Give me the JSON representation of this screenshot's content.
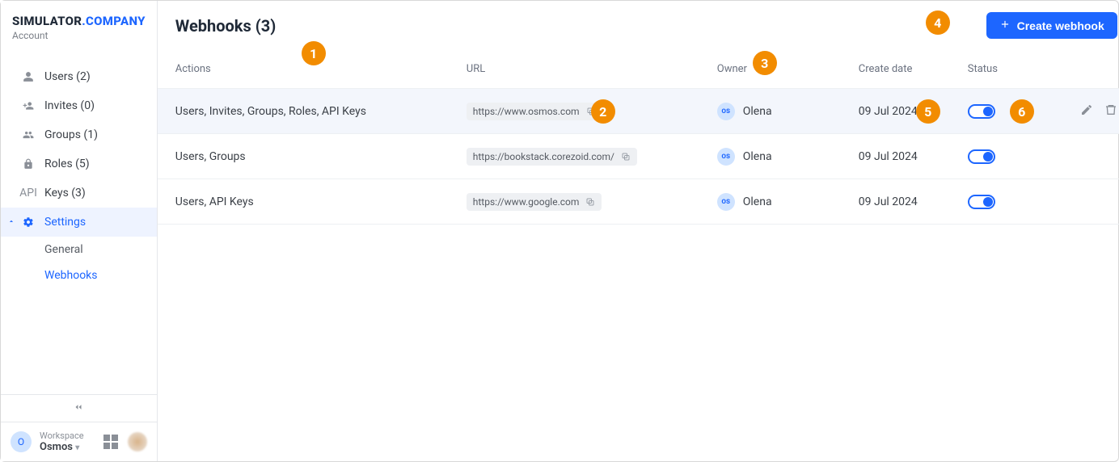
{
  "brand": {
    "text_black": "SIMULATOR",
    "text_dot": ".",
    "text_blue": "COMPANY",
    "sub": "Account"
  },
  "sidebar": {
    "items": [
      {
        "label": "Users (2)"
      },
      {
        "label": "Invites (0)"
      },
      {
        "label": "Groups (1)"
      },
      {
        "label": "Roles (5)"
      },
      {
        "api_prefix": "API",
        "label": "Keys (3)"
      },
      {
        "label": "Settings"
      }
    ],
    "sub": [
      {
        "label": "General"
      },
      {
        "label": "Webhooks"
      }
    ]
  },
  "workspace": {
    "avatar_letter": "O",
    "label": "Workspace",
    "name": "Osmos"
  },
  "header": {
    "title": "Webhooks (3)",
    "create_label": "Create webhook"
  },
  "columns": {
    "actions": "Actions",
    "url": "URL",
    "owner": "Owner",
    "date": "Create date",
    "status": "Status"
  },
  "rows": [
    {
      "actions": "Users, Invites, Groups, Roles, API Keys",
      "url": "https://www.osmos.com",
      "owner_initials": "os",
      "owner_name": "Olena",
      "date": "09 Jul 2024"
    },
    {
      "actions": "Users, Groups",
      "url": "https://bookstack.corezoid.com/",
      "owner_initials": "os",
      "owner_name": "Olena",
      "date": "09 Jul 2024"
    },
    {
      "actions": "Users, API Keys",
      "url": "https://www.google.com",
      "owner_initials": "os",
      "owner_name": "Olena",
      "date": "09 Jul 2024"
    }
  ],
  "callouts": {
    "c1": "1",
    "c2": "2",
    "c3": "3",
    "c4": "4",
    "c5": "5",
    "c6": "6"
  }
}
